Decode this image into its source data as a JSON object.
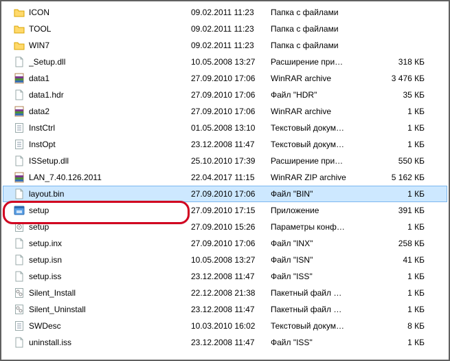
{
  "highlight_index": 11,
  "highlight_width": 266,
  "files": [
    {
      "icon": "folder",
      "name": "ICON",
      "date": "09.02.2011 11:23",
      "type": "Папка с файлами",
      "size": ""
    },
    {
      "icon": "folder",
      "name": "TOOL",
      "date": "09.02.2011 11:23",
      "type": "Папка с файлами",
      "size": ""
    },
    {
      "icon": "folder",
      "name": "WIN7",
      "date": "09.02.2011 11:23",
      "type": "Папка с файлами",
      "size": ""
    },
    {
      "icon": "file",
      "name": "_Setup.dll",
      "date": "10.05.2008 13:27",
      "type": "Расширение при…",
      "size": "318 КБ"
    },
    {
      "icon": "rar",
      "name": "data1",
      "date": "27.09.2010 17:06",
      "type": "WinRAR archive",
      "size": "3 476 КБ"
    },
    {
      "icon": "file",
      "name": "data1.hdr",
      "date": "27.09.2010 17:06",
      "type": "Файл \"HDR\"",
      "size": "35 КБ"
    },
    {
      "icon": "rar",
      "name": "data2",
      "date": "27.09.2010 17:06",
      "type": "WinRAR archive",
      "size": "1 КБ"
    },
    {
      "icon": "txt",
      "name": "InstCtrl",
      "date": "01.05.2008 13:10",
      "type": "Текстовый докум…",
      "size": "1 КБ"
    },
    {
      "icon": "txt",
      "name": "InstOpt",
      "date": "23.12.2008 11:47",
      "type": "Текстовый докум…",
      "size": "1 КБ"
    },
    {
      "icon": "file",
      "name": "ISSetup.dll",
      "date": "25.10.2010 17:39",
      "type": "Расширение при…",
      "size": "550 КБ"
    },
    {
      "icon": "rar",
      "name": "LAN_7.40.126.2011",
      "date": "22.04.2017 11:15",
      "type": "WinRAR ZIP archive",
      "size": "5 162 КБ"
    },
    {
      "icon": "file",
      "name": "layout.bin",
      "date": "27.09.2010 17:06",
      "type": "Файл \"BIN\"",
      "size": "1 КБ",
      "selected": true
    },
    {
      "icon": "exe",
      "name": "setup",
      "date": "27.09.2010 17:15",
      "type": "Приложение",
      "size": "391 КБ"
    },
    {
      "icon": "cfg",
      "name": "setup",
      "date": "27.09.2010 15:26",
      "type": "Параметры конф…",
      "size": "1 КБ"
    },
    {
      "icon": "file",
      "name": "setup.inx",
      "date": "27.09.2010 17:06",
      "type": "Файл \"INX\"",
      "size": "258 КБ"
    },
    {
      "icon": "file",
      "name": "setup.isn",
      "date": "10.05.2008 13:27",
      "type": "Файл \"ISN\"",
      "size": "41 КБ"
    },
    {
      "icon": "file",
      "name": "setup.iss",
      "date": "23.12.2008 11:47",
      "type": "Файл \"ISS\"",
      "size": "1 КБ"
    },
    {
      "icon": "bat",
      "name": "Silent_Install",
      "date": "22.12.2008 21:38",
      "type": "Пакетный файл …",
      "size": "1 КБ"
    },
    {
      "icon": "bat",
      "name": "Silent_Uninstall",
      "date": "23.12.2008 11:47",
      "type": "Пакетный файл …",
      "size": "1 КБ"
    },
    {
      "icon": "txt",
      "name": "SWDesc",
      "date": "10.03.2010 16:02",
      "type": "Текстовый докум…",
      "size": "8 КБ"
    },
    {
      "icon": "file",
      "name": "uninstall.iss",
      "date": "23.12.2008 11:47",
      "type": "Файл \"ISS\"",
      "size": "1 КБ"
    }
  ]
}
